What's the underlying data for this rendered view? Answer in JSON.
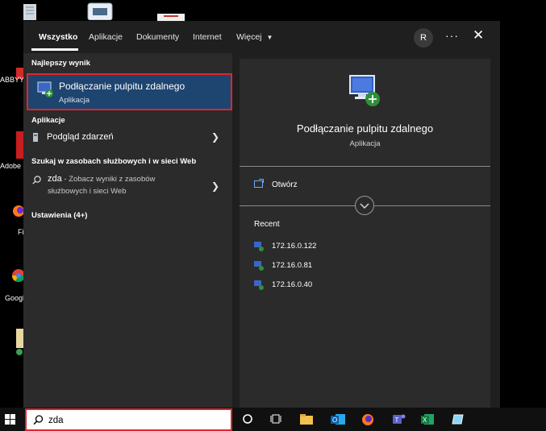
{
  "desktop": {
    "labels": [
      "ABBYY F",
      "Adobe",
      "Fi",
      "Googl"
    ]
  },
  "tabs": [
    {
      "label": "Wszystko",
      "active": true
    },
    {
      "label": "Aplikacje"
    },
    {
      "label": "Dokumenty"
    },
    {
      "label": "Internet"
    },
    {
      "label": "Więcej"
    }
  ],
  "header": {
    "avatar": "R",
    "more": "···",
    "close": "✕"
  },
  "left": {
    "best_match_heading": "Najlepszy wynik",
    "best_match": {
      "title": "Podłączanie pulpitu zdalnego",
      "subtitle": "Aplikacja"
    },
    "apps_heading": "Aplikacje",
    "app_item": "Podgląd zdarzeń",
    "web_heading": "Szukaj w zasobach służbowych i w sieci Web",
    "web_query": "zda",
    "web_line1": " - Zobacz wyniki z zasobów",
    "web_line2": "służbowych i sieci Web",
    "settings_heading": "Ustawienia (4+)"
  },
  "right": {
    "title": "Podłączanie pulpitu zdalnego",
    "subtitle": "Aplikacja",
    "open_label": "Otwórz",
    "recent_label": "Recent",
    "recent": [
      "172.16.0.122",
      "172.16.0.81",
      "172.16.0.40"
    ]
  },
  "search": {
    "value": "zda"
  },
  "colors": {
    "accent": "#1e4470",
    "highlight_border": "#e0262d",
    "pane": "#2b2b2b"
  }
}
